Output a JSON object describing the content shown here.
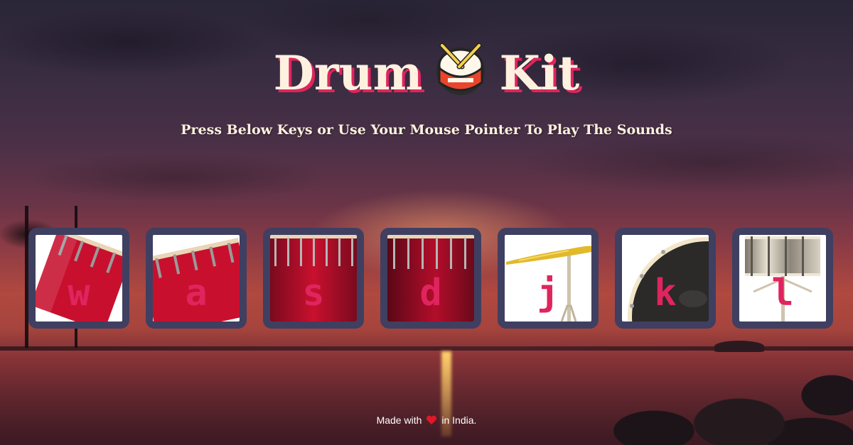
{
  "header": {
    "title_left": "Drum",
    "title_right": "Kit",
    "emoji_icon": "drum-icon",
    "subtitle": "Press Below Keys or Use Your Mouse Pointer To Play The Sounds"
  },
  "keys": [
    {
      "letter": "w",
      "instrument": "tom-1-icon"
    },
    {
      "letter": "a",
      "instrument": "tom-2-icon"
    },
    {
      "letter": "s",
      "instrument": "tom-3-icon"
    },
    {
      "letter": "d",
      "instrument": "tom-4-icon"
    },
    {
      "letter": "j",
      "instrument": "crash-cymbal-icon"
    },
    {
      "letter": "k",
      "instrument": "kick-drum-icon"
    },
    {
      "letter": "l",
      "instrument": "snare-icon"
    }
  ],
  "footer": {
    "prefix": "Made with",
    "suffix": "in India.",
    "heart_icon": "heart-icon"
  },
  "colors": {
    "accent": "#e0245e",
    "title": "#fff1df",
    "key_border": "#3f3f61"
  }
}
